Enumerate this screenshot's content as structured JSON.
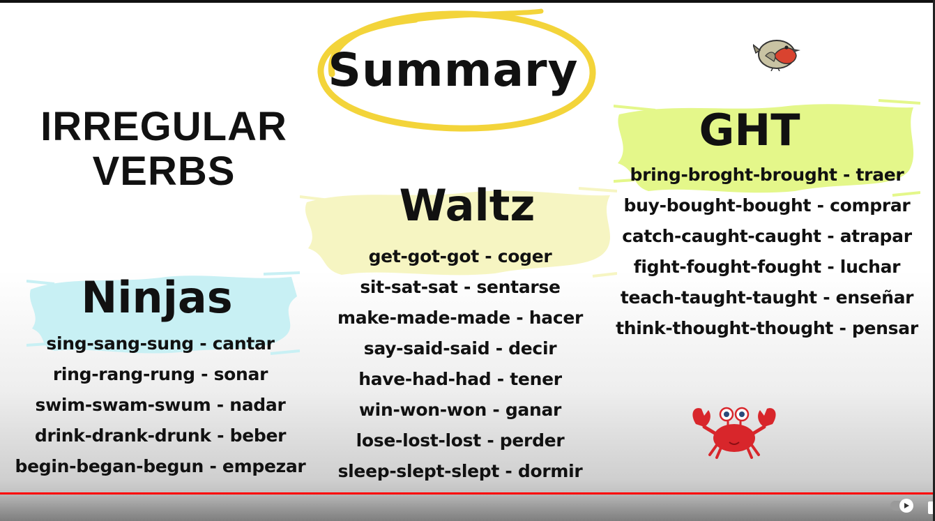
{
  "slide": {
    "title_line1": "IRREGULAR",
    "title_line2": "VERBS",
    "summary": "Summary"
  },
  "colors": {
    "cyan_brush": "#c8f0f4",
    "yellow_brush": "#f6f5c2",
    "green_brush": "#e4f78a",
    "oval": "#f3d43a",
    "progress": "#ff0000"
  },
  "groups": {
    "ninjas": {
      "heading": "Ninjas",
      "verbs": [
        "sing-sang-sung - cantar",
        "ring-rang-rung - sonar",
        "swim-swam-swum - nadar",
        "drink-drank-drunk - beber",
        "begin-began-begun - empezar"
      ]
    },
    "waltz": {
      "heading": "Waltz",
      "verbs": [
        "get-got-got - coger",
        "sit-sat-sat - sentarse",
        "make-made-made - hacer",
        "say-said-said - decir",
        "have-had-had - tener",
        "win-won-won - ganar",
        "lose-lost-lost - perder",
        "sleep-slept-slept - dormir"
      ]
    },
    "ght": {
      "heading": "GHT",
      "verbs": [
        "bring-broght-brought - traer",
        "buy-bought-bought - comprar",
        "catch-caught-caught - atrapar",
        "fight-fought-fought - luchar",
        "teach-taught-taught - enseñar",
        "think-thought-thought - pensar"
      ]
    }
  },
  "icons": {
    "bird": "robin-bird-icon",
    "crab": "crab-icon",
    "autoplay": "autoplay-toggle-icon",
    "subtitles": "subtitles-icon"
  },
  "player": {
    "progress_fraction": 1.0
  }
}
